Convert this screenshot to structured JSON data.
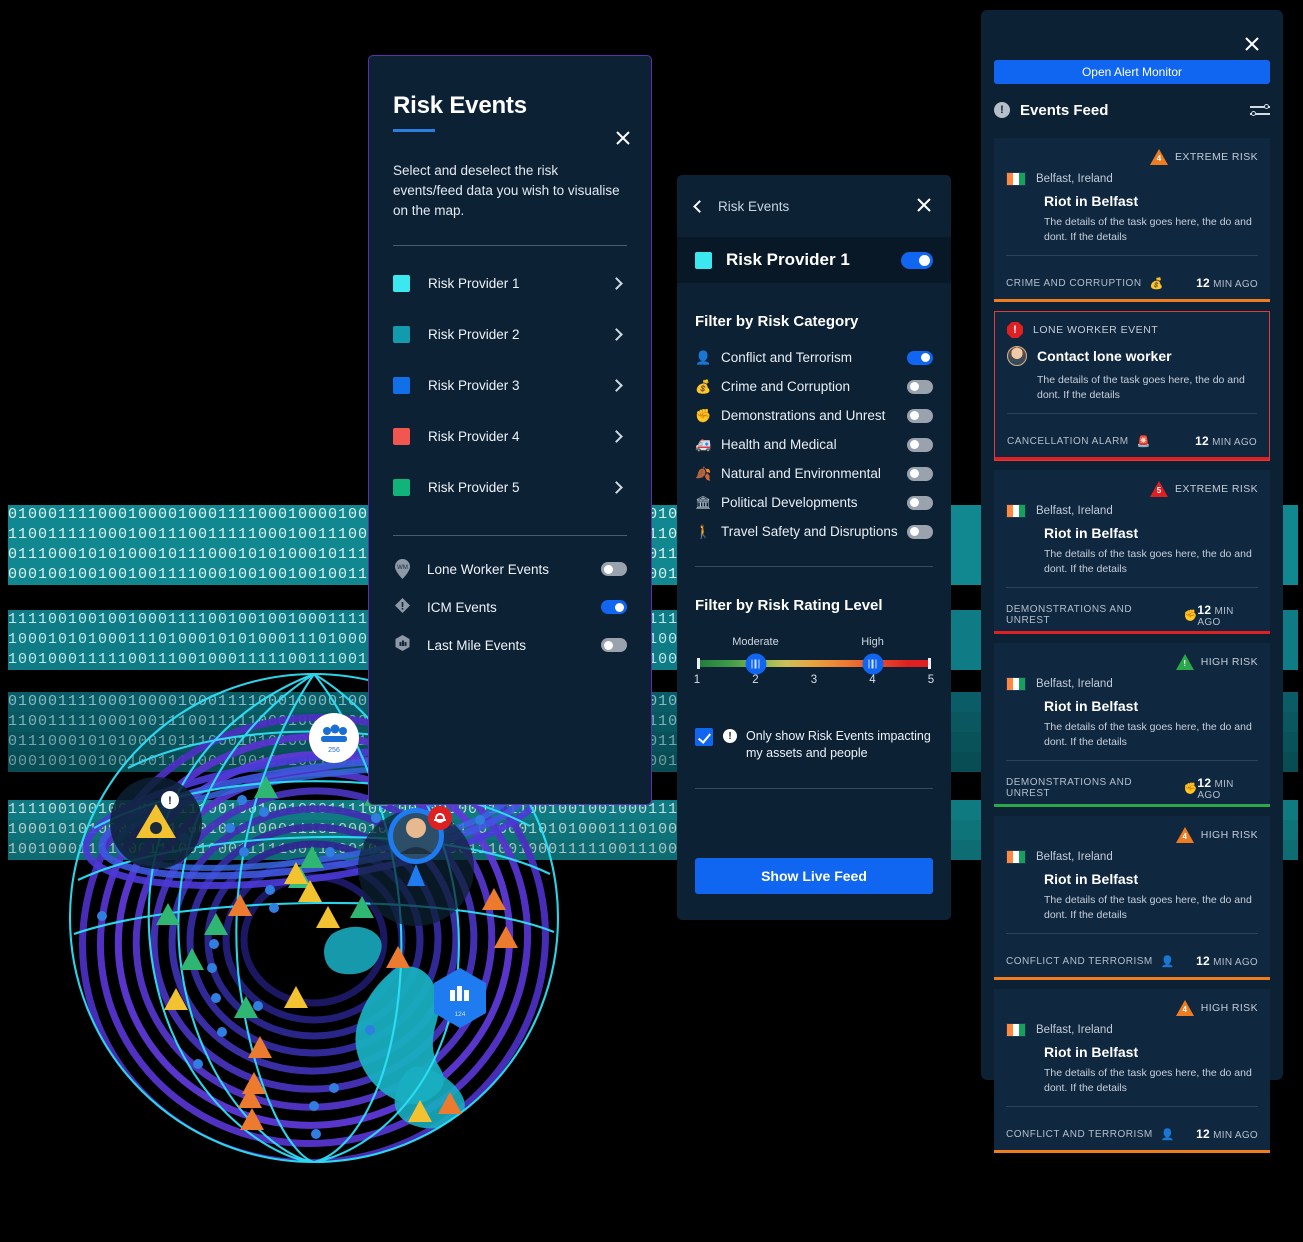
{
  "risk_events_panel": {
    "title": "Risk Events",
    "close_label": "close-icon",
    "description": "Select and deselect the risk events/feed data you wish to visualise on the map.",
    "providers": [
      {
        "label": "Risk Provider 1",
        "color": "#3ce8f0"
      },
      {
        "label": "Risk Provider 2",
        "color": "#119bad"
      },
      {
        "label": "Risk Provider 3",
        "color": "#1070e8"
      },
      {
        "label": "Risk Provider 4",
        "color": "#f2574f"
      },
      {
        "label": "Risk Provider 5",
        "color": "#12b37a"
      }
    ],
    "feeds": [
      {
        "label": "Lone Worker Events",
        "icon": "lone-worker-pin-icon",
        "on": false
      },
      {
        "label": "ICM Events",
        "icon": "icm-diamond-icon",
        "on": true
      },
      {
        "label": "Last Mile Events",
        "icon": "last-mile-pin-icon",
        "on": false
      }
    ]
  },
  "provider_panel": {
    "back_label": "Risk Events",
    "provider_name": "Risk Provider 1",
    "provider_color": "#3ce8f0",
    "provider_enabled": true,
    "category_heading": "Filter by Risk Category",
    "categories": [
      {
        "label": "Conflict and Terrorism",
        "icon": "&#128100;",
        "on": true
      },
      {
        "label": "Crime and Corruption",
        "icon": "&#128176;",
        "on": false
      },
      {
        "label": "Demonstrations and Unrest",
        "icon": "&#9994;",
        "on": false
      },
      {
        "label": "Health and Medical",
        "icon": "&#128657;",
        "on": false
      },
      {
        "label": "Natural and Environmental",
        "icon": "&#127810;",
        "on": false
      },
      {
        "label": "Political Developments",
        "icon": "&#127963;",
        "on": false
      },
      {
        "label": "Travel Safety and Disruptions",
        "icon": "&#128694;",
        "on": false
      }
    ],
    "rating_heading": "Filter by Risk Rating Level",
    "rating": {
      "low_tag": "Moderate",
      "high_tag": "High",
      "ticks": [
        "1",
        "2",
        "3",
        "4",
        "5"
      ],
      "low_value": 2,
      "high_value": 4
    },
    "checkbox_label": "Only show Risk Events impacting my assets and people",
    "checkbox_checked": true,
    "submit_label": "Show Live Feed"
  },
  "feed_panel": {
    "close_label": "close-icon",
    "open_alert_monitor": "Open Alert Monitor",
    "feed_heading": "Events Feed",
    "filter_icon": "feed-filter-icon",
    "events": [
      {
        "type": "risk",
        "risk_level": "EXTREME RISK",
        "risk_score": "4",
        "risk_color": "#ef7d20",
        "location": "Belfast, Ireland",
        "flag": "ireland-flag",
        "title": "Riot in Belfast",
        "description": "The details of the task goes here, the do and dont. If the details",
        "category": "CRIME AND CORRUPTION",
        "category_icon": "&#128176;",
        "time_value": "12",
        "time_unit": "MIN AGO"
      },
      {
        "type": "lone_worker",
        "kind_label": "LONE WORKER EVENT",
        "title": "Contact  lone worker",
        "description": "The details of the task goes here, the do and dont. If the details",
        "category": "CANCELLATION  ALARM",
        "category_icon": "&#128680;",
        "time_value": "12",
        "time_unit": "MIN AGO",
        "risk_color": "#e02020"
      },
      {
        "type": "risk",
        "risk_level": "EXTREME RISK",
        "risk_score": "5",
        "risk_color": "#e02020",
        "location": "Belfast, Ireland",
        "flag": "ireland-flag",
        "title": "Riot in Belfast",
        "description": "The details of the task goes here, the do and dont. If the details",
        "category": "DEMONSTRATIONS AND UNREST",
        "category_icon": "&#9994;",
        "time_value": "12",
        "time_unit": "MIN AGO"
      },
      {
        "type": "risk",
        "risk_level": "HIGH RISK",
        "risk_score": "!",
        "risk_color": "#2aa84a",
        "location": "Belfast, Ireland",
        "flag": "ireland-flag",
        "title": "Riot in Belfast",
        "description": "The details of the task goes here, the do and dont. If the details",
        "category": "DEMONSTRATIONS AND UNREST",
        "category_icon": "&#9994;",
        "time_value": "12",
        "time_unit": "MIN AGO"
      },
      {
        "type": "risk",
        "risk_level": "HIGH RISK",
        "risk_score": "4",
        "risk_color": "#ef7d20",
        "location": "Belfast, Ireland",
        "flag": "ireland-flag",
        "title": "Riot in Belfast",
        "description": "The details of the task goes here, the do and dont. If the details",
        "category": "CONFLICT AND TERRORISM",
        "category_icon": "&#128100;",
        "time_value": "12",
        "time_unit": "MIN AGO"
      },
      {
        "type": "risk",
        "risk_level": "HIGH RISK",
        "risk_score": "4",
        "risk_color": "#ef7d20",
        "location": "Belfast, Ireland",
        "flag": "ireland-flag",
        "title": "Riot in Belfast",
        "description": "The details of the task goes here, the do and dont. If the details",
        "category": "CONFLICT AND TERRORISM",
        "category_icon": "&#128100;",
        "time_value": "12",
        "time_unit": "MIN AGO"
      }
    ]
  },
  "globe": {
    "people_badge_count": "256",
    "facility_badge_count": "124",
    "alert_badge_icon": "warning-fist-icon",
    "worker_pin_icon": "worker-avatar-pin"
  },
  "background": {
    "binary_rows": [
      "01000111100010000100011110001000010001111000100001000111100010000100011110001000",
      "11001111100010011100111110001001110011111000100111001111100010011100111110001001",
      "01110001010100010111000101010001011100010101000101110001010100010111000101010001",
      "00010010010010011110001001001001001111000100100100100111100010010010010011110001"
    ],
    "binary_rows_2": [
      "11110010010010001111001001001000111100100100100011110010010010001111001001001000",
      "10001010100011101000101010001110100010101000111010001010100011101000101010001110",
      "10010001111100111001000111110011100100011111001110010001111100111001000111110011",
      "00010010010010011110001001001001001111000100100100100111100010010010010011110001"
    ]
  }
}
